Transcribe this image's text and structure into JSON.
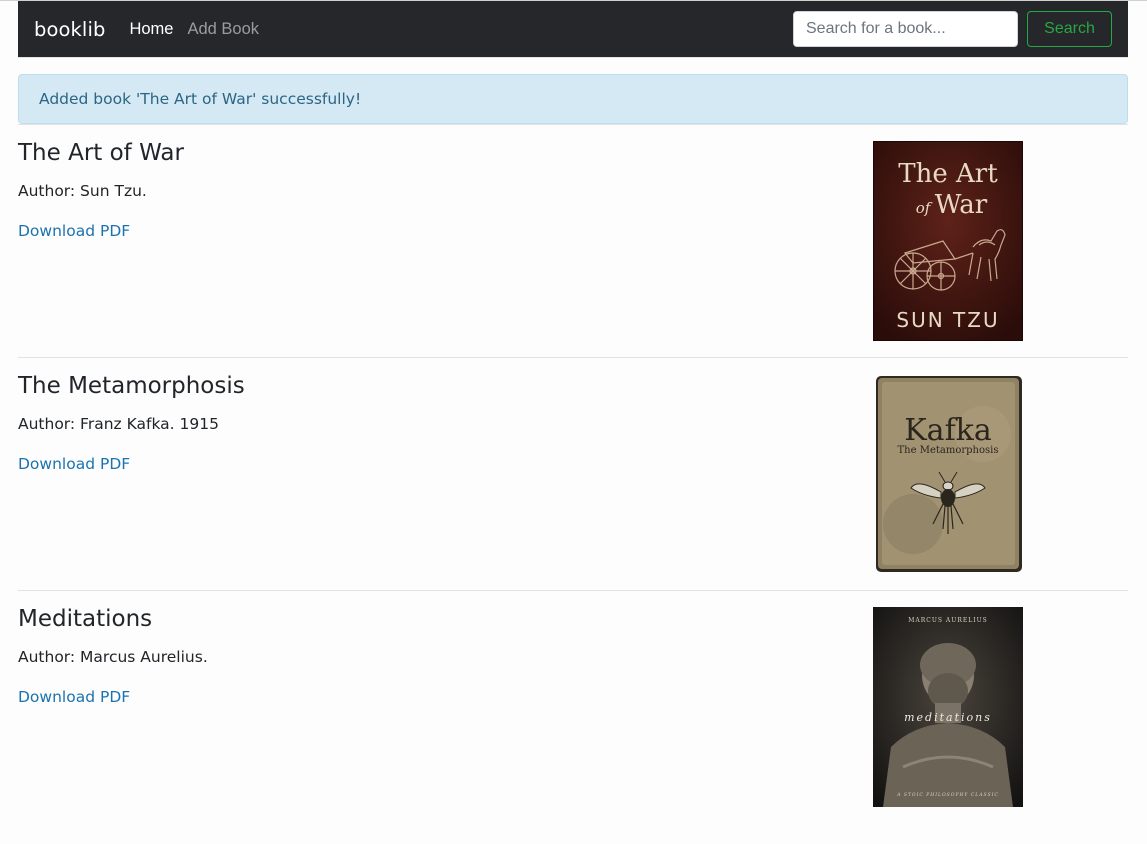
{
  "navbar": {
    "brand": "booklib",
    "links": [
      {
        "label": "Home",
        "active": true
      },
      {
        "label": "Add Book",
        "active": false
      }
    ],
    "search": {
      "placeholder": "Search for a book...",
      "value": "",
      "button_label": "Search"
    }
  },
  "alert": {
    "message": "Added book 'The Art of War' successfully!"
  },
  "books": [
    {
      "title": "The Art of War",
      "author": "Author: Sun Tzu.",
      "download_label": "Download PDF",
      "cover": {
        "line1": "The Art",
        "line2": "War",
        "small": "of",
        "author": "SUN TZU"
      }
    },
    {
      "title": "The Metamorphosis",
      "author": "Author: Franz Kafka. 1915",
      "download_label": "Download PDF",
      "cover": {
        "name": "Kafka",
        "subtitle": "The Metamorphosis"
      }
    },
    {
      "title": "Meditations",
      "author": "Author: Marcus Aurelius.",
      "download_label": "Download PDF",
      "cover": {
        "author": "MARCUS AURELIUS",
        "title": "meditations",
        "tagline": "A STOIC PHILOSOPHY CLASSIC"
      }
    }
  ],
  "colors": {
    "navbar_bg": "#25272a",
    "success": "#28a745",
    "link": "#1a73b0",
    "alert_bg": "#d4e9f3",
    "alert_text": "#2d6585"
  }
}
